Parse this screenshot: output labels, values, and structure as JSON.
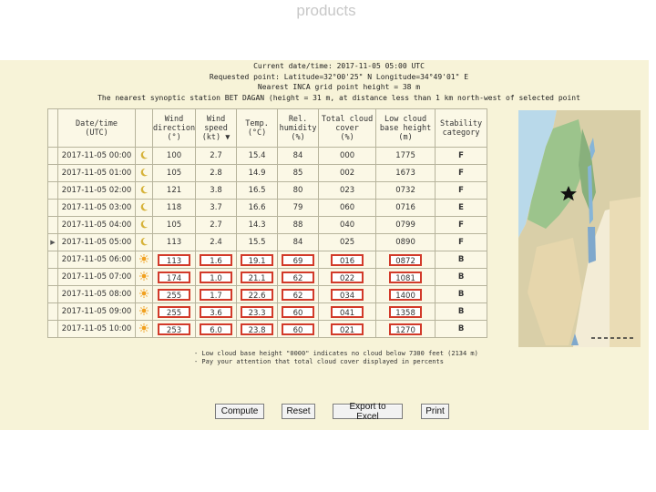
{
  "slide": {
    "title": "products"
  },
  "info": {
    "line1": "Current date/time: 2017-11-05 05:00 UTC",
    "line2": "Requested point: Latitude=32°00'25\" N Longitude=34°49'01\" E",
    "line3": "Nearest INCA grid point height = 38 m",
    "line4": "The nearest synoptic station BET DAGAN (height = 31 m, at distance less than 1 km north-west of selected point"
  },
  "table": {
    "headers": {
      "date": [
        "Date/time",
        "(UTC)"
      ],
      "wind_dir": [
        "Wind",
        "direction",
        "(°)"
      ],
      "wind_speed": [
        "Wind",
        "speed",
        "(kt)"
      ],
      "wind_speed_unit_marker": "▼",
      "temp": [
        "Temp.",
        "(°C)"
      ],
      "humidity": [
        "Rel.",
        "humidity",
        "(%)"
      ],
      "cloud_cover": [
        "Total cloud",
        "cover",
        "(%)"
      ],
      "cloud_base": [
        "Low cloud",
        "base height",
        "(m)"
      ],
      "stability": [
        "Stability",
        "category"
      ]
    },
    "current_row_marker": "▶",
    "rows": [
      {
        "date": "2017-11-05 00:00",
        "icon": "moon",
        "dir": "100",
        "speed": "2.7",
        "temp": "15.4",
        "hum": "84",
        "cloud": "000",
        "base": "1775",
        "stab": "F",
        "highlight": false,
        "current": false
      },
      {
        "date": "2017-11-05 01:00",
        "icon": "moon",
        "dir": "105",
        "speed": "2.8",
        "temp": "14.9",
        "hum": "85",
        "cloud": "002",
        "base": "1673",
        "stab": "F",
        "highlight": false,
        "current": false
      },
      {
        "date": "2017-11-05 02:00",
        "icon": "moon",
        "dir": "121",
        "speed": "3.8",
        "temp": "16.5",
        "hum": "80",
        "cloud": "023",
        "base": "0732",
        "stab": "F",
        "highlight": false,
        "current": false
      },
      {
        "date": "2017-11-05 03:00",
        "icon": "moon",
        "dir": "118",
        "speed": "3.7",
        "temp": "16.6",
        "hum": "79",
        "cloud": "060",
        "base": "0716",
        "stab": "E",
        "highlight": false,
        "current": false
      },
      {
        "date": "2017-11-05 04:00",
        "icon": "moon",
        "dir": "105",
        "speed": "2.7",
        "temp": "14.3",
        "hum": "88",
        "cloud": "040",
        "base": "0799",
        "stab": "F",
        "highlight": false,
        "current": false
      },
      {
        "date": "2017-11-05 05:00",
        "icon": "moon",
        "dir": "113",
        "speed": "2.4",
        "temp": "15.5",
        "hum": "84",
        "cloud": "025",
        "base": "0890",
        "stab": "F",
        "highlight": false,
        "current": true
      },
      {
        "date": "2017-11-05 06:00",
        "icon": "sun",
        "dir": "113",
        "speed": "1.6",
        "temp": "19.1",
        "hum": "69",
        "cloud": "016",
        "base": "0872",
        "stab": "B",
        "highlight": true,
        "current": false
      },
      {
        "date": "2017-11-05 07:00",
        "icon": "sun",
        "dir": "174",
        "speed": "1.0",
        "temp": "21.1",
        "hum": "62",
        "cloud": "022",
        "base": "1081",
        "stab": "B",
        "highlight": true,
        "current": false
      },
      {
        "date": "2017-11-05 08:00",
        "icon": "sun",
        "dir": "255",
        "speed": "1.7",
        "temp": "22.6",
        "hum": "62",
        "cloud": "034",
        "base": "1400",
        "stab": "B",
        "highlight": true,
        "current": false
      },
      {
        "date": "2017-11-05 09:00",
        "icon": "sun",
        "dir": "255",
        "speed": "3.6",
        "temp": "23.3",
        "hum": "60",
        "cloud": "041",
        "base": "1358",
        "stab": "B",
        "highlight": true,
        "current": false
      },
      {
        "date": "2017-11-05 10:00",
        "icon": "sun",
        "dir": "253",
        "speed": "6.0",
        "temp": "23.8",
        "hum": "60",
        "cloud": "021",
        "base": "1270",
        "stab": "B",
        "highlight": true,
        "current": false
      }
    ]
  },
  "footnotes": {
    "note1": "- Low cloud base height \"0000\" indicates no cloud below 7300 feet (2134 m)",
    "note2": "- Pay your attention that total cloud cover displayed in percents"
  },
  "buttons": {
    "compute": "Compute",
    "reset": "Reset",
    "export": "Export to Excel",
    "print": "Print"
  },
  "icons": {
    "night": "crescent-moon-icon",
    "day": "sun-icon",
    "location": "star-icon"
  },
  "colors": {
    "panel_bg": "#f7f3d8",
    "highlight_border": "#d23a2a",
    "sun": "#f0a020",
    "moon": "#d6b23a"
  }
}
